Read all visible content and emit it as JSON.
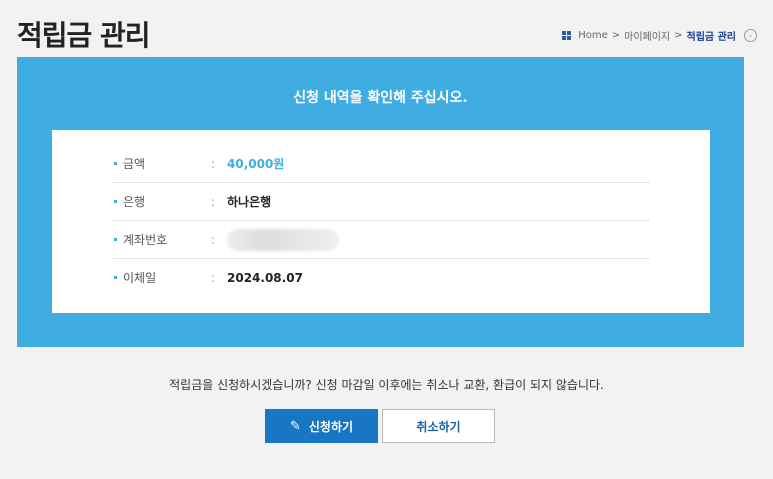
{
  "header": {
    "title": "적립금 관리",
    "breadcrumb": {
      "home": "Home",
      "sep1": ">",
      "mypage": "마이페이지",
      "sep2": ">",
      "current": "적립금 관리",
      "toggle_icon": "chevron-down-icon"
    }
  },
  "panel": {
    "heading": "신청 내역을 확인해 주십시오.",
    "colon": ":",
    "rows": [
      {
        "label": "금액",
        "value": "40,000원"
      },
      {
        "label": "은행",
        "value": "하나은행"
      },
      {
        "label": "계좌번호",
        "value": ""
      },
      {
        "label": "이체일",
        "value": "2024.08.07"
      }
    ]
  },
  "notice": "적립금을 신청하시겠습니까? 신청 마감일 이후에는 취소나 교환, 환급이 되지 않습니다.",
  "buttons": {
    "apply_label": "신청하기",
    "apply_icon": "pencil-icon",
    "cancel_label": "취소하기"
  },
  "colors": {
    "accent": "#40ade2",
    "primary_button": "#1976c4",
    "background": "#f2f2f2"
  }
}
